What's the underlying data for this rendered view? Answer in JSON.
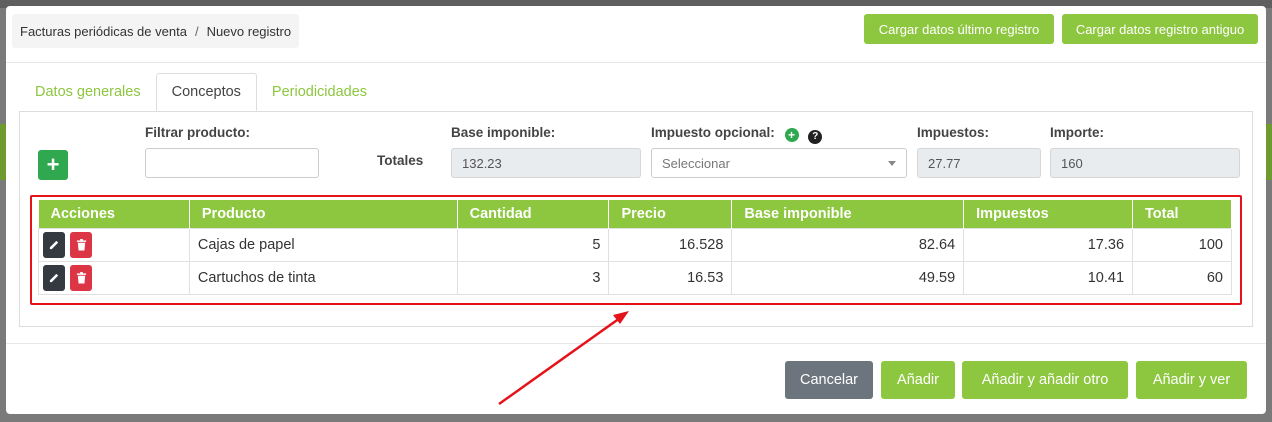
{
  "breadcrumb": {
    "parent": "Facturas periódicas de venta",
    "separator": "/",
    "current": "Nuevo registro"
  },
  "top_buttons": {
    "load_last": "Cargar datos último registro",
    "load_old": "Cargar datos registro antiguo"
  },
  "tabs": [
    {
      "label": "Datos generales",
      "active": false
    },
    {
      "label": "Conceptos",
      "active": true
    },
    {
      "label": "Periodicidades",
      "active": false
    }
  ],
  "filters": {
    "filter_label": "Filtrar producto:",
    "filter_value": "",
    "totals_label": "Totales",
    "base_label": "Base imponible:",
    "base_value": "132.23",
    "tax_opt_label": "Impuesto opcional:",
    "tax_opt_placeholder": "Seleccionar",
    "taxes_label": "Impuestos:",
    "taxes_value": "27.77",
    "amount_label": "Importe:",
    "amount_value": "160"
  },
  "table": {
    "headers": [
      "Acciones",
      "Producto",
      "Cantidad",
      "Precio",
      "Base imponible",
      "Impuestos",
      "Total"
    ],
    "rows": [
      {
        "producto": "Cajas de papel",
        "cantidad": "5",
        "precio": "16.528",
        "base": "82.64",
        "impuestos": "17.36",
        "total": "100"
      },
      {
        "producto": "Cartuchos de tinta",
        "cantidad": "3",
        "precio": "16.53",
        "base": "49.59",
        "impuestos": "10.41",
        "total": "60"
      }
    ]
  },
  "footer": {
    "cancel": "Cancelar",
    "add": "Añadir",
    "add_another": "Añadir y añadir otro",
    "add_view": "Añadir y ver"
  },
  "colors": {
    "accent": "#8dc63f",
    "add_green": "#2fa84f",
    "danger": "#dc3545",
    "dark": "#343a40",
    "annotation": "#e5121a"
  },
  "icons": {
    "add": "plus-icon",
    "edit": "pencil-icon",
    "delete": "trash-icon",
    "help": "question-icon",
    "dropdown": "chevron-down-icon"
  }
}
